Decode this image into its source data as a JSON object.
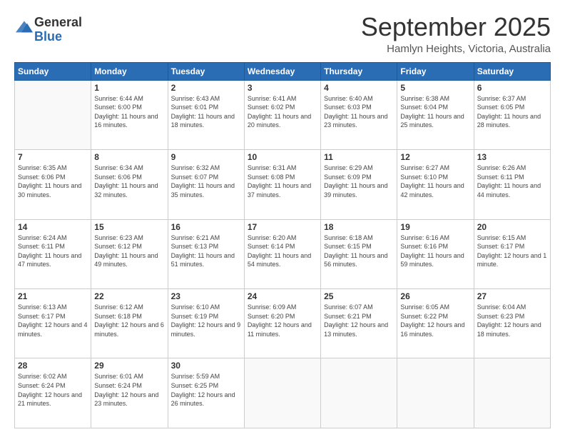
{
  "header": {
    "logo_general": "General",
    "logo_blue": "Blue",
    "month_title": "September 2025",
    "location": "Hamlyn Heights, Victoria, Australia"
  },
  "weekdays": [
    "Sunday",
    "Monday",
    "Tuesday",
    "Wednesday",
    "Thursday",
    "Friday",
    "Saturday"
  ],
  "weeks": [
    [
      {
        "day": "",
        "sunrise": "",
        "sunset": "",
        "daylight": ""
      },
      {
        "day": "1",
        "sunrise": "Sunrise: 6:44 AM",
        "sunset": "Sunset: 6:00 PM",
        "daylight": "Daylight: 11 hours and 16 minutes."
      },
      {
        "day": "2",
        "sunrise": "Sunrise: 6:43 AM",
        "sunset": "Sunset: 6:01 PM",
        "daylight": "Daylight: 11 hours and 18 minutes."
      },
      {
        "day": "3",
        "sunrise": "Sunrise: 6:41 AM",
        "sunset": "Sunset: 6:02 PM",
        "daylight": "Daylight: 11 hours and 20 minutes."
      },
      {
        "day": "4",
        "sunrise": "Sunrise: 6:40 AM",
        "sunset": "Sunset: 6:03 PM",
        "daylight": "Daylight: 11 hours and 23 minutes."
      },
      {
        "day": "5",
        "sunrise": "Sunrise: 6:38 AM",
        "sunset": "Sunset: 6:04 PM",
        "daylight": "Daylight: 11 hours and 25 minutes."
      },
      {
        "day": "6",
        "sunrise": "Sunrise: 6:37 AM",
        "sunset": "Sunset: 6:05 PM",
        "daylight": "Daylight: 11 hours and 28 minutes."
      }
    ],
    [
      {
        "day": "7",
        "sunrise": "Sunrise: 6:35 AM",
        "sunset": "Sunset: 6:06 PM",
        "daylight": "Daylight: 11 hours and 30 minutes."
      },
      {
        "day": "8",
        "sunrise": "Sunrise: 6:34 AM",
        "sunset": "Sunset: 6:06 PM",
        "daylight": "Daylight: 11 hours and 32 minutes."
      },
      {
        "day": "9",
        "sunrise": "Sunrise: 6:32 AM",
        "sunset": "Sunset: 6:07 PM",
        "daylight": "Daylight: 11 hours and 35 minutes."
      },
      {
        "day": "10",
        "sunrise": "Sunrise: 6:31 AM",
        "sunset": "Sunset: 6:08 PM",
        "daylight": "Daylight: 11 hours and 37 minutes."
      },
      {
        "day": "11",
        "sunrise": "Sunrise: 6:29 AM",
        "sunset": "Sunset: 6:09 PM",
        "daylight": "Daylight: 11 hours and 39 minutes."
      },
      {
        "day": "12",
        "sunrise": "Sunrise: 6:27 AM",
        "sunset": "Sunset: 6:10 PM",
        "daylight": "Daylight: 11 hours and 42 minutes."
      },
      {
        "day": "13",
        "sunrise": "Sunrise: 6:26 AM",
        "sunset": "Sunset: 6:11 PM",
        "daylight": "Daylight: 11 hours and 44 minutes."
      }
    ],
    [
      {
        "day": "14",
        "sunrise": "Sunrise: 6:24 AM",
        "sunset": "Sunset: 6:11 PM",
        "daylight": "Daylight: 11 hours and 47 minutes."
      },
      {
        "day": "15",
        "sunrise": "Sunrise: 6:23 AM",
        "sunset": "Sunset: 6:12 PM",
        "daylight": "Daylight: 11 hours and 49 minutes."
      },
      {
        "day": "16",
        "sunrise": "Sunrise: 6:21 AM",
        "sunset": "Sunset: 6:13 PM",
        "daylight": "Daylight: 11 hours and 51 minutes."
      },
      {
        "day": "17",
        "sunrise": "Sunrise: 6:20 AM",
        "sunset": "Sunset: 6:14 PM",
        "daylight": "Daylight: 11 hours and 54 minutes."
      },
      {
        "day": "18",
        "sunrise": "Sunrise: 6:18 AM",
        "sunset": "Sunset: 6:15 PM",
        "daylight": "Daylight: 11 hours and 56 minutes."
      },
      {
        "day": "19",
        "sunrise": "Sunrise: 6:16 AM",
        "sunset": "Sunset: 6:16 PM",
        "daylight": "Daylight: 11 hours and 59 minutes."
      },
      {
        "day": "20",
        "sunrise": "Sunrise: 6:15 AM",
        "sunset": "Sunset: 6:17 PM",
        "daylight": "Daylight: 12 hours and 1 minute."
      }
    ],
    [
      {
        "day": "21",
        "sunrise": "Sunrise: 6:13 AM",
        "sunset": "Sunset: 6:17 PM",
        "daylight": "Daylight: 12 hours and 4 minutes."
      },
      {
        "day": "22",
        "sunrise": "Sunrise: 6:12 AM",
        "sunset": "Sunset: 6:18 PM",
        "daylight": "Daylight: 12 hours and 6 minutes."
      },
      {
        "day": "23",
        "sunrise": "Sunrise: 6:10 AM",
        "sunset": "Sunset: 6:19 PM",
        "daylight": "Daylight: 12 hours and 9 minutes."
      },
      {
        "day": "24",
        "sunrise": "Sunrise: 6:09 AM",
        "sunset": "Sunset: 6:20 PM",
        "daylight": "Daylight: 12 hours and 11 minutes."
      },
      {
        "day": "25",
        "sunrise": "Sunrise: 6:07 AM",
        "sunset": "Sunset: 6:21 PM",
        "daylight": "Daylight: 12 hours and 13 minutes."
      },
      {
        "day": "26",
        "sunrise": "Sunrise: 6:05 AM",
        "sunset": "Sunset: 6:22 PM",
        "daylight": "Daylight: 12 hours and 16 minutes."
      },
      {
        "day": "27",
        "sunrise": "Sunrise: 6:04 AM",
        "sunset": "Sunset: 6:23 PM",
        "daylight": "Daylight: 12 hours and 18 minutes."
      }
    ],
    [
      {
        "day": "28",
        "sunrise": "Sunrise: 6:02 AM",
        "sunset": "Sunset: 6:24 PM",
        "daylight": "Daylight: 12 hours and 21 minutes."
      },
      {
        "day": "29",
        "sunrise": "Sunrise: 6:01 AM",
        "sunset": "Sunset: 6:24 PM",
        "daylight": "Daylight: 12 hours and 23 minutes."
      },
      {
        "day": "30",
        "sunrise": "Sunrise: 5:59 AM",
        "sunset": "Sunset: 6:25 PM",
        "daylight": "Daylight: 12 hours and 26 minutes."
      },
      {
        "day": "",
        "sunrise": "",
        "sunset": "",
        "daylight": ""
      },
      {
        "day": "",
        "sunrise": "",
        "sunset": "",
        "daylight": ""
      },
      {
        "day": "",
        "sunrise": "",
        "sunset": "",
        "daylight": ""
      },
      {
        "day": "",
        "sunrise": "",
        "sunset": "",
        "daylight": ""
      }
    ]
  ]
}
